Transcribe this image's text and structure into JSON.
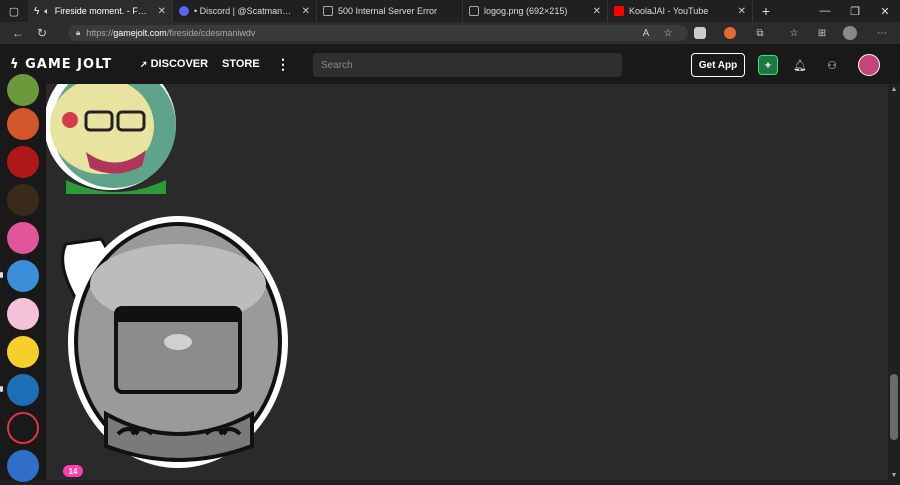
{
  "browser": {
    "tabs": [
      {
        "title": "Fireside moment. - Fires",
        "icon": "gamejolt-icon",
        "active": true,
        "color": "#2c2c2c"
      },
      {
        "title": "• Discord | @ScatmanJones",
        "icon": "discord-icon",
        "color": "#5865f2"
      },
      {
        "title": "500 Internal Server Error",
        "icon": "page-icon",
        "color": "#888888"
      },
      {
        "title": "logog.png (692×215)",
        "icon": "page-icon",
        "color": "#888888"
      },
      {
        "title": "KoolaJAI - YouTube",
        "icon": "youtube-icon",
        "color": "#ff0000"
      }
    ],
    "url_scheme": "https://",
    "url_host": "gamejolt.com",
    "url_path": "/fireside/cdesmaniwdv"
  },
  "gamejolt": {
    "logo": "GAME JOLT",
    "nav_discover": "DISCOVER",
    "nav_store": "STORE",
    "search_placeholder": "Search",
    "get_app": "Get App",
    "notification_count": "14"
  },
  "colors": {
    "accent": "#ff3fac",
    "bg": "#2a2a2a",
    "topbar": "#191919"
  }
}
